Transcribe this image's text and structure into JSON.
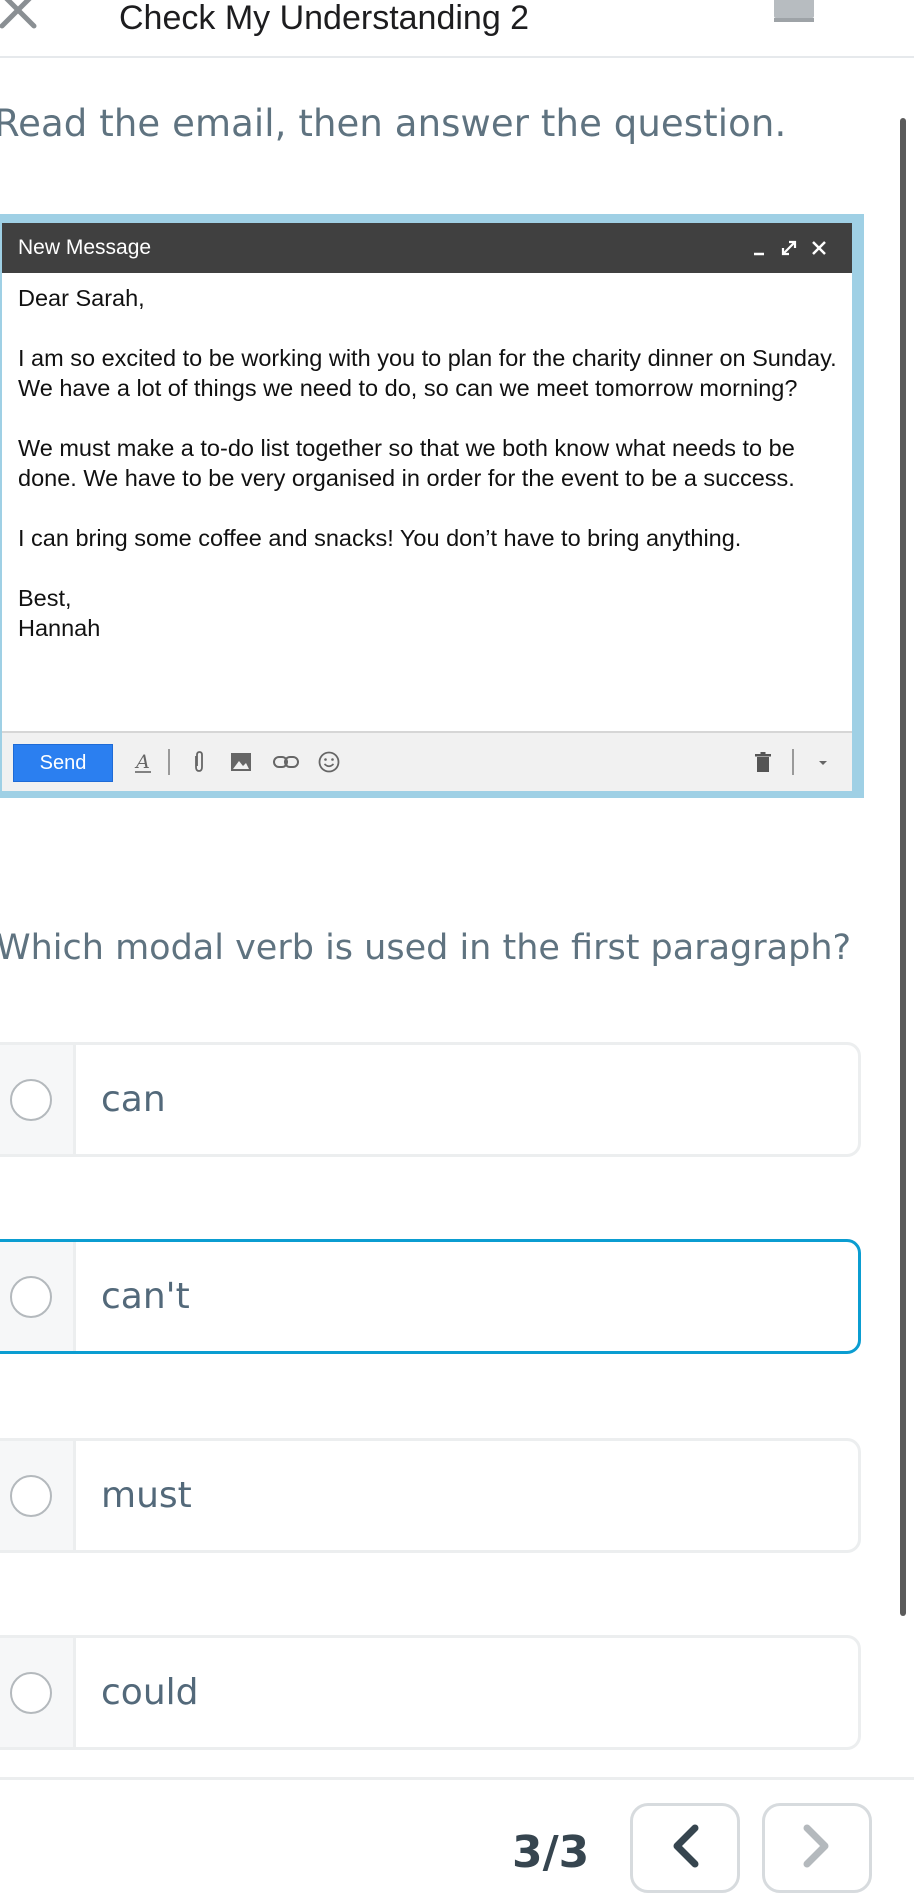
{
  "header": {
    "title": "Check My Understanding 2",
    "close_icon": "close-icon",
    "glossary_icon": "glossary-book-icon"
  },
  "instruction": "Read the email, then answer the question.",
  "email": {
    "window_title": "New Message",
    "header_icons": [
      "minimize-icon",
      "expand-icon",
      "close-icon"
    ],
    "greeting": "Dear Sarah,",
    "paragraphs": [
      "I am so excited to be working with you to plan for the charity dinner on Sunday. We have a lot of things we need to do, so can we meet tomorrow morning?",
      "We must make a to-do list together so that we both know what needs to be done. We have to be very organised in order for the event to be a success.",
      "I can bring some coffee and snacks! You don’t have to bring anything."
    ],
    "signoff": "Best,",
    "signature": "Hannah",
    "toolbar": {
      "send_label": "Send",
      "icons": [
        "text-format-icon",
        "attach-icon",
        "insert-photo-icon",
        "link-icon",
        "emoji-icon",
        "trash-icon",
        "more-options-icon"
      ]
    }
  },
  "question": "Which modal verb is used in the first paragraph?",
  "options": [
    {
      "label": "can",
      "selected": false
    },
    {
      "label": "can't",
      "selected": false
    },
    {
      "label": "must",
      "selected": false
    },
    {
      "label": "could",
      "selected": false
    }
  ],
  "focused_option_index": 1,
  "footer": {
    "progress": "3/3",
    "prev_icon": "chevron-left-icon",
    "next_icon": "chevron-right-icon"
  },
  "colors": {
    "accent": "#0b9dd1",
    "email_frame": "#9fd0e5",
    "email_header": "#404040",
    "send_button": "#2b7ff0",
    "prompt_text": "#5f7380"
  }
}
